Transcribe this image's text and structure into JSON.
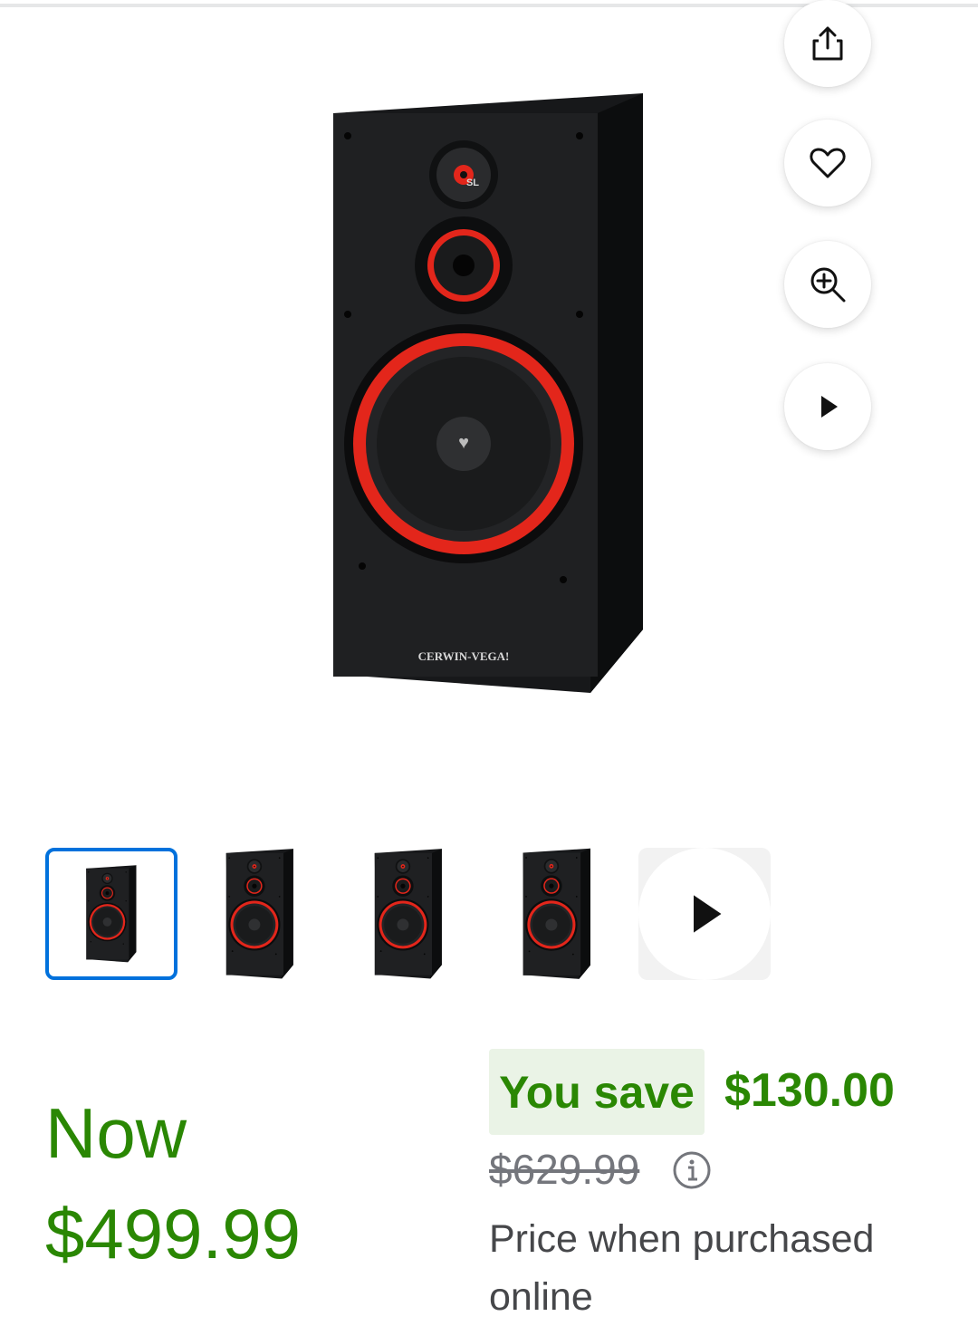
{
  "product": {
    "image_alt": "Cerwin-Vega SL-15 floor speaker",
    "brand_text": "CERWIN-VEGA!",
    "tweeter_text": "SL"
  },
  "actions": [
    {
      "name": "share-icon"
    },
    {
      "name": "heart-icon"
    },
    {
      "name": "zoom-in-icon"
    },
    {
      "name": "play-icon"
    }
  ],
  "thumbnails": {
    "count": 5,
    "selected_index": 0,
    "last_is_video": true
  },
  "pricing": {
    "now_label": "Now",
    "now_price": "$499.99",
    "save_label": "You save",
    "save_amount": "$130.00",
    "was_price": "$629.99",
    "note": "Price when purchased online"
  },
  "colors": {
    "price_green": "#2a8703",
    "save_badge_bg": "#eaf3e6",
    "selected_border": "#0071dc",
    "speaker_red": "#e3261b"
  }
}
